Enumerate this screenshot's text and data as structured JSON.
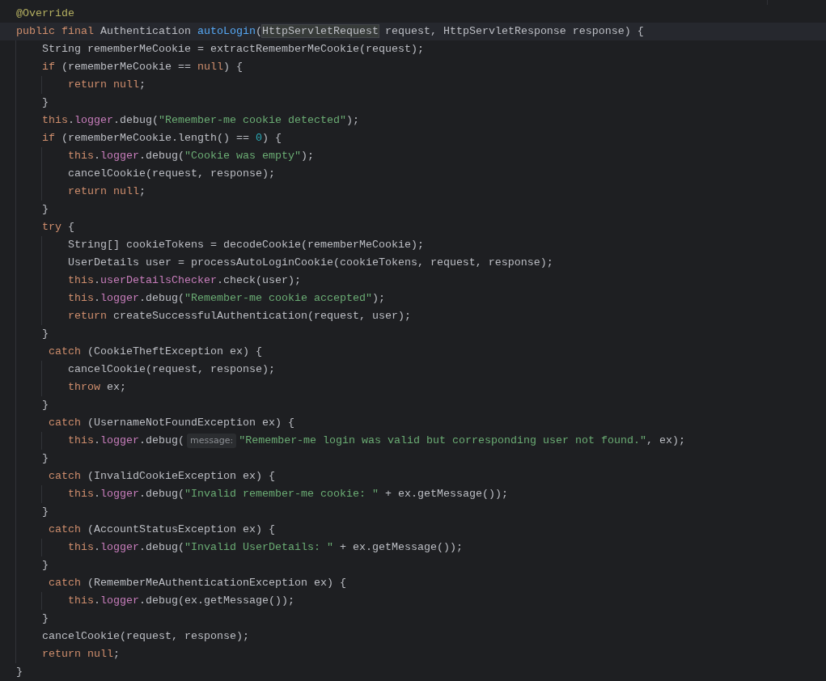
{
  "editor": {
    "lines": [
      {
        "current": false,
        "tokens": [
          {
            "kind": "annotation",
            "text": "@Override"
          }
        ]
      },
      {
        "current": true,
        "tokens": [
          {
            "kind": "keyword",
            "text": "public final "
          },
          {
            "kind": "plain",
            "text": "Authentication "
          },
          {
            "kind": "method",
            "text": "autoLogin"
          },
          {
            "kind": "plain",
            "text": "("
          },
          {
            "kind": "usage",
            "text": "HttpServletRequest"
          },
          {
            "kind": "plain",
            "text": " request, HttpServletResponse response) {"
          }
        ]
      },
      {
        "current": false,
        "tokens": [
          {
            "kind": "plain",
            "text": "    String rememberMeCookie = extractRememberMeCookie(request);"
          }
        ]
      },
      {
        "current": false,
        "tokens": [
          {
            "kind": "keyword",
            "text": "    if "
          },
          {
            "kind": "plain",
            "text": "(rememberMeCookie == "
          },
          {
            "kind": "keyword",
            "text": "null"
          },
          {
            "kind": "plain",
            "text": ") {"
          }
        ]
      },
      {
        "current": false,
        "tokens": [
          {
            "kind": "keyword",
            "text": "        return null"
          },
          {
            "kind": "plain",
            "text": ";"
          }
        ]
      },
      {
        "current": false,
        "tokens": [
          {
            "kind": "plain",
            "text": "    }"
          }
        ]
      },
      {
        "current": false,
        "tokens": [
          {
            "kind": "keyword",
            "text": "    this"
          },
          {
            "kind": "plain",
            "text": "."
          },
          {
            "kind": "field",
            "text": "logger"
          },
          {
            "kind": "plain",
            "text": ".debug("
          },
          {
            "kind": "string",
            "text": "\"Remember-me cookie detected\""
          },
          {
            "kind": "plain",
            "text": ");"
          }
        ]
      },
      {
        "current": false,
        "tokens": [
          {
            "kind": "keyword",
            "text": "    if "
          },
          {
            "kind": "plain",
            "text": "(rememberMeCookie.length() == "
          },
          {
            "kind": "number",
            "text": "0"
          },
          {
            "kind": "plain",
            "text": ") {"
          }
        ]
      },
      {
        "current": false,
        "tokens": [
          {
            "kind": "keyword",
            "text": "        this"
          },
          {
            "kind": "plain",
            "text": "."
          },
          {
            "kind": "field",
            "text": "logger"
          },
          {
            "kind": "plain",
            "text": ".debug("
          },
          {
            "kind": "string",
            "text": "\"Cookie was empty\""
          },
          {
            "kind": "plain",
            "text": ");"
          }
        ]
      },
      {
        "current": false,
        "tokens": [
          {
            "kind": "plain",
            "text": "        cancelCookie(request, response);"
          }
        ]
      },
      {
        "current": false,
        "tokens": [
          {
            "kind": "keyword",
            "text": "        return null"
          },
          {
            "kind": "plain",
            "text": ";"
          }
        ]
      },
      {
        "current": false,
        "tokens": [
          {
            "kind": "plain",
            "text": "    }"
          }
        ]
      },
      {
        "current": false,
        "tokens": [
          {
            "kind": "keyword",
            "text": "    try "
          },
          {
            "kind": "plain",
            "text": "{"
          }
        ]
      },
      {
        "current": false,
        "tokens": [
          {
            "kind": "plain",
            "text": "        String[] cookieTokens = decodeCookie(rememberMeCookie);"
          }
        ]
      },
      {
        "current": false,
        "tokens": [
          {
            "kind": "plain",
            "text": "        UserDetails user = processAutoLoginCookie(cookieTokens, request, response);"
          }
        ]
      },
      {
        "current": false,
        "tokens": [
          {
            "kind": "keyword",
            "text": "        this"
          },
          {
            "kind": "plain",
            "text": "."
          },
          {
            "kind": "field",
            "text": "userDetailsChecker"
          },
          {
            "kind": "plain",
            "text": ".check(user);"
          }
        ]
      },
      {
        "current": false,
        "tokens": [
          {
            "kind": "keyword",
            "text": "        this"
          },
          {
            "kind": "plain",
            "text": "."
          },
          {
            "kind": "field",
            "text": "logger"
          },
          {
            "kind": "plain",
            "text": ".debug("
          },
          {
            "kind": "string",
            "text": "\"Remember-me cookie accepted\""
          },
          {
            "kind": "plain",
            "text": ");"
          }
        ]
      },
      {
        "current": false,
        "tokens": [
          {
            "kind": "keyword",
            "text": "        return "
          },
          {
            "kind": "plain",
            "text": "createSuccessfulAuthentication(request, user);"
          }
        ]
      },
      {
        "current": false,
        "tokens": [
          {
            "kind": "plain",
            "text": "    }"
          }
        ]
      },
      {
        "current": false,
        "tokens": [
          {
            "kind": "keyword",
            "text": "     catch "
          },
          {
            "kind": "plain",
            "text": "(CookieTheftException ex) {"
          }
        ]
      },
      {
        "current": false,
        "tokens": [
          {
            "kind": "plain",
            "text": "        cancelCookie(request, response);"
          }
        ]
      },
      {
        "current": false,
        "tokens": [
          {
            "kind": "keyword",
            "text": "        throw "
          },
          {
            "kind": "plain",
            "text": "ex;"
          }
        ]
      },
      {
        "current": false,
        "tokens": [
          {
            "kind": "plain",
            "text": "    }"
          }
        ]
      },
      {
        "current": false,
        "tokens": [
          {
            "kind": "keyword",
            "text": "     catch "
          },
          {
            "kind": "plain",
            "text": "(UsernameNotFoundException ex) {"
          }
        ]
      },
      {
        "current": false,
        "tokens": [
          {
            "kind": "keyword",
            "text": "        this"
          },
          {
            "kind": "plain",
            "text": "."
          },
          {
            "kind": "field",
            "text": "logger"
          },
          {
            "kind": "plain",
            "text": ".debug("
          },
          {
            "kind": "hint",
            "text": "message:"
          },
          {
            "kind": "string",
            "text": "\"Remember-me login was valid but corresponding user not found.\""
          },
          {
            "kind": "plain",
            "text": ", ex);"
          }
        ]
      },
      {
        "current": false,
        "tokens": [
          {
            "kind": "plain",
            "text": "    }"
          }
        ]
      },
      {
        "current": false,
        "tokens": [
          {
            "kind": "keyword",
            "text": "     catch "
          },
          {
            "kind": "plain",
            "text": "(InvalidCookieException ex) {"
          }
        ]
      },
      {
        "current": false,
        "tokens": [
          {
            "kind": "keyword",
            "text": "        this"
          },
          {
            "kind": "plain",
            "text": "."
          },
          {
            "kind": "field",
            "text": "logger"
          },
          {
            "kind": "plain",
            "text": ".debug("
          },
          {
            "kind": "string",
            "text": "\"Invalid remember-me cookie: \""
          },
          {
            "kind": "plain",
            "text": " + ex.getMessage());"
          }
        ]
      },
      {
        "current": false,
        "tokens": [
          {
            "kind": "plain",
            "text": "    }"
          }
        ]
      },
      {
        "current": false,
        "tokens": [
          {
            "kind": "keyword",
            "text": "     catch "
          },
          {
            "kind": "plain",
            "text": "(AccountStatusException ex) {"
          }
        ]
      },
      {
        "current": false,
        "tokens": [
          {
            "kind": "keyword",
            "text": "        this"
          },
          {
            "kind": "plain",
            "text": "."
          },
          {
            "kind": "field",
            "text": "logger"
          },
          {
            "kind": "plain",
            "text": ".debug("
          },
          {
            "kind": "string",
            "text": "\"Invalid UserDetails: \""
          },
          {
            "kind": "plain",
            "text": " + ex.getMessage());"
          }
        ]
      },
      {
        "current": false,
        "tokens": [
          {
            "kind": "plain",
            "text": "    }"
          }
        ]
      },
      {
        "current": false,
        "tokens": [
          {
            "kind": "keyword",
            "text": "     catch "
          },
          {
            "kind": "plain",
            "text": "(RememberMeAuthenticationException ex) {"
          }
        ]
      },
      {
        "current": false,
        "tokens": [
          {
            "kind": "keyword",
            "text": "        this"
          },
          {
            "kind": "plain",
            "text": "."
          },
          {
            "kind": "field",
            "text": "logger"
          },
          {
            "kind": "plain",
            "text": ".debug(ex.getMessage());"
          }
        ]
      },
      {
        "current": false,
        "tokens": [
          {
            "kind": "plain",
            "text": "    }"
          }
        ]
      },
      {
        "current": false,
        "tokens": [
          {
            "kind": "plain",
            "text": "    cancelCookie(request, response);"
          }
        ]
      },
      {
        "current": false,
        "tokens": [
          {
            "kind": "keyword",
            "text": "    return null"
          },
          {
            "kind": "plain",
            "text": ";"
          }
        ]
      },
      {
        "current": false,
        "tokens": [
          {
            "kind": "plain",
            "text": "}"
          }
        ]
      }
    ]
  }
}
